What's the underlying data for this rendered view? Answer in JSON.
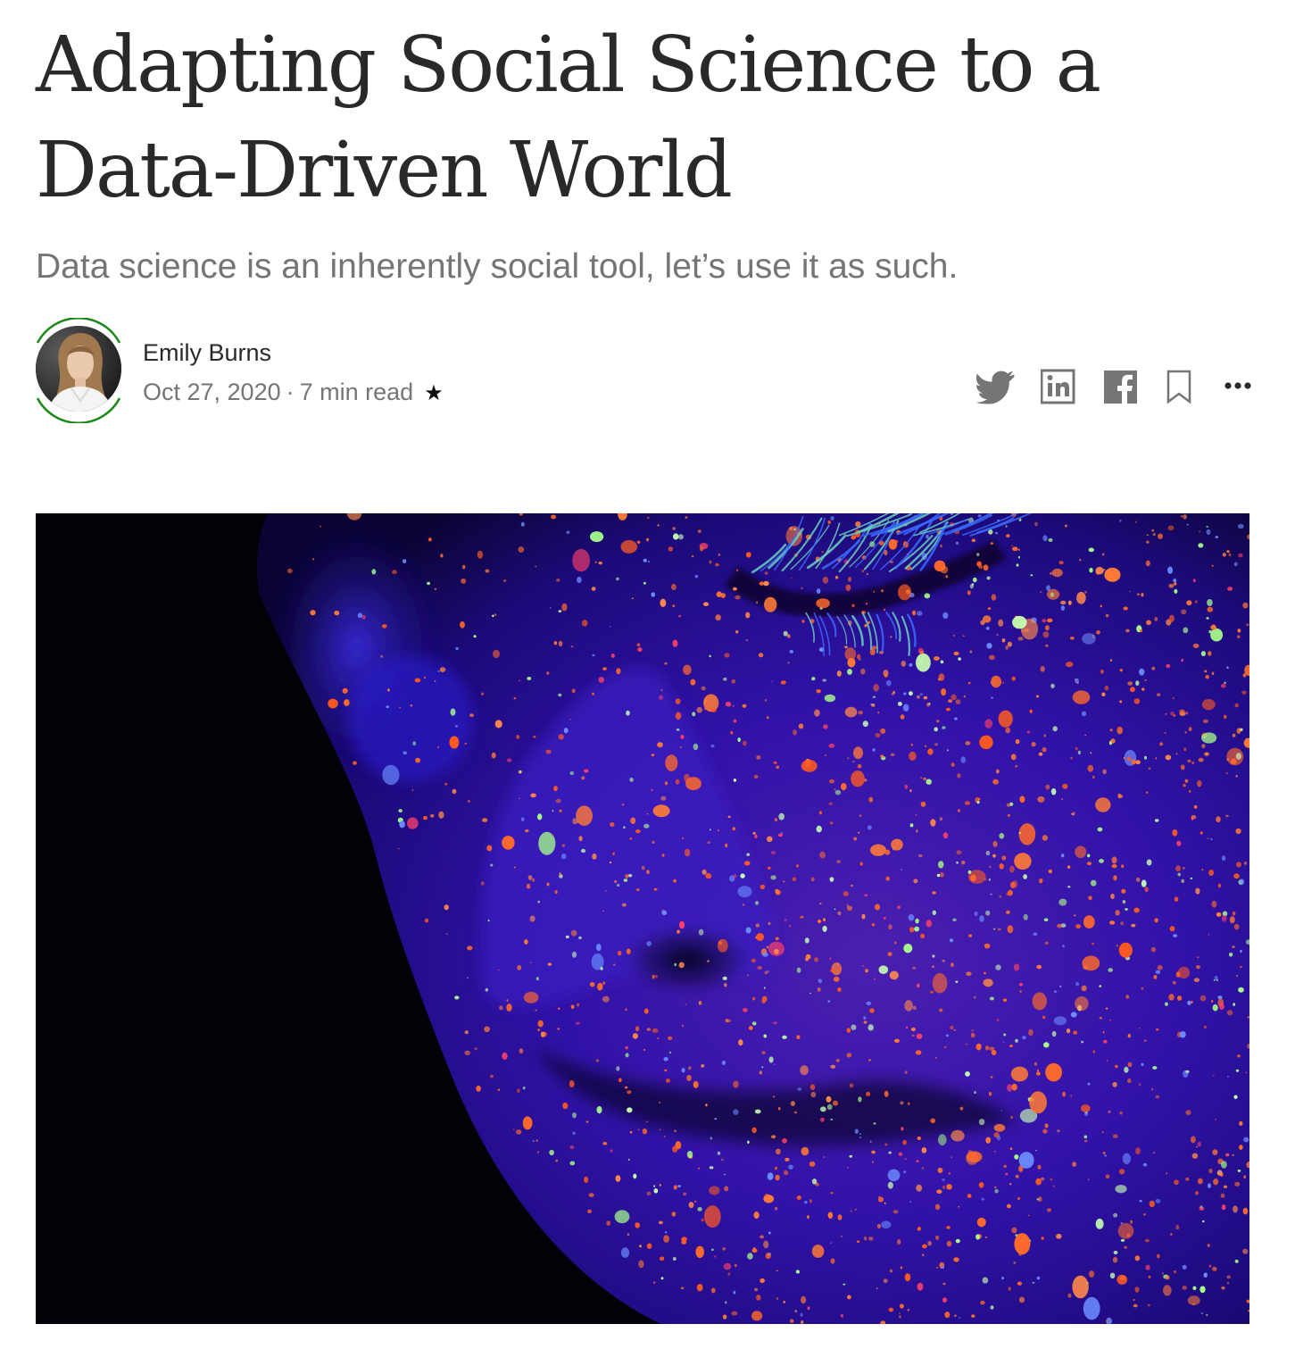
{
  "article": {
    "title": "Adapting Social Science to a Data-Driven World",
    "subtitle": "Data science is an inherently social tool, let’s use it as such."
  },
  "author": {
    "name": "Emily Burns",
    "date": "Oct 27, 2020",
    "separator": "·",
    "read_time": "7 min read",
    "member_star": "★"
  },
  "actions": {
    "icons": [
      "twitter-icon",
      "linkedin-icon",
      "facebook-icon",
      "bookmark-icon",
      "more-icon"
    ]
  },
  "colors": {
    "text_primary": "#292929",
    "text_secondary": "#757575",
    "avatar_ring": "#1a8917",
    "icon_gray": "#757575"
  }
}
